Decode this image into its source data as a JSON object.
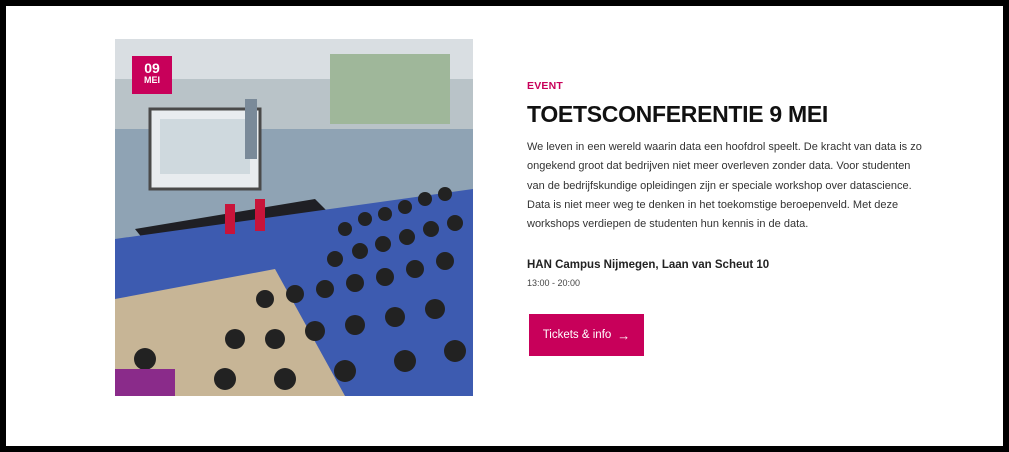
{
  "event": {
    "date_day": "09",
    "date_month": "MEI",
    "eyebrow": "EVENT",
    "title": "TOETSCONFERENTIE 9 MEI",
    "description": "We leven in een wereld waarin data een hoofdrol speelt. De kracht van data is zo ongekend groot dat bedrijven niet meer overleven zonder data. Voor studenten van de bedrijfskundige opleidingen zijn er speciale workshop over datascience. Data is niet meer weg te denken in het toekomstige beroepenveld. Met deze workshops verdiepen de studenten hun kennis in de data.",
    "location": "HAN Campus Nijmegen, Laan van Scheut 10",
    "time": "13:00 - 20:00",
    "button_label": "Tickets & info",
    "arrow_icon": "arrow-right-icon"
  },
  "colors": {
    "accent": "#c8005a",
    "background": "#ffffff",
    "frame": "#000000"
  }
}
